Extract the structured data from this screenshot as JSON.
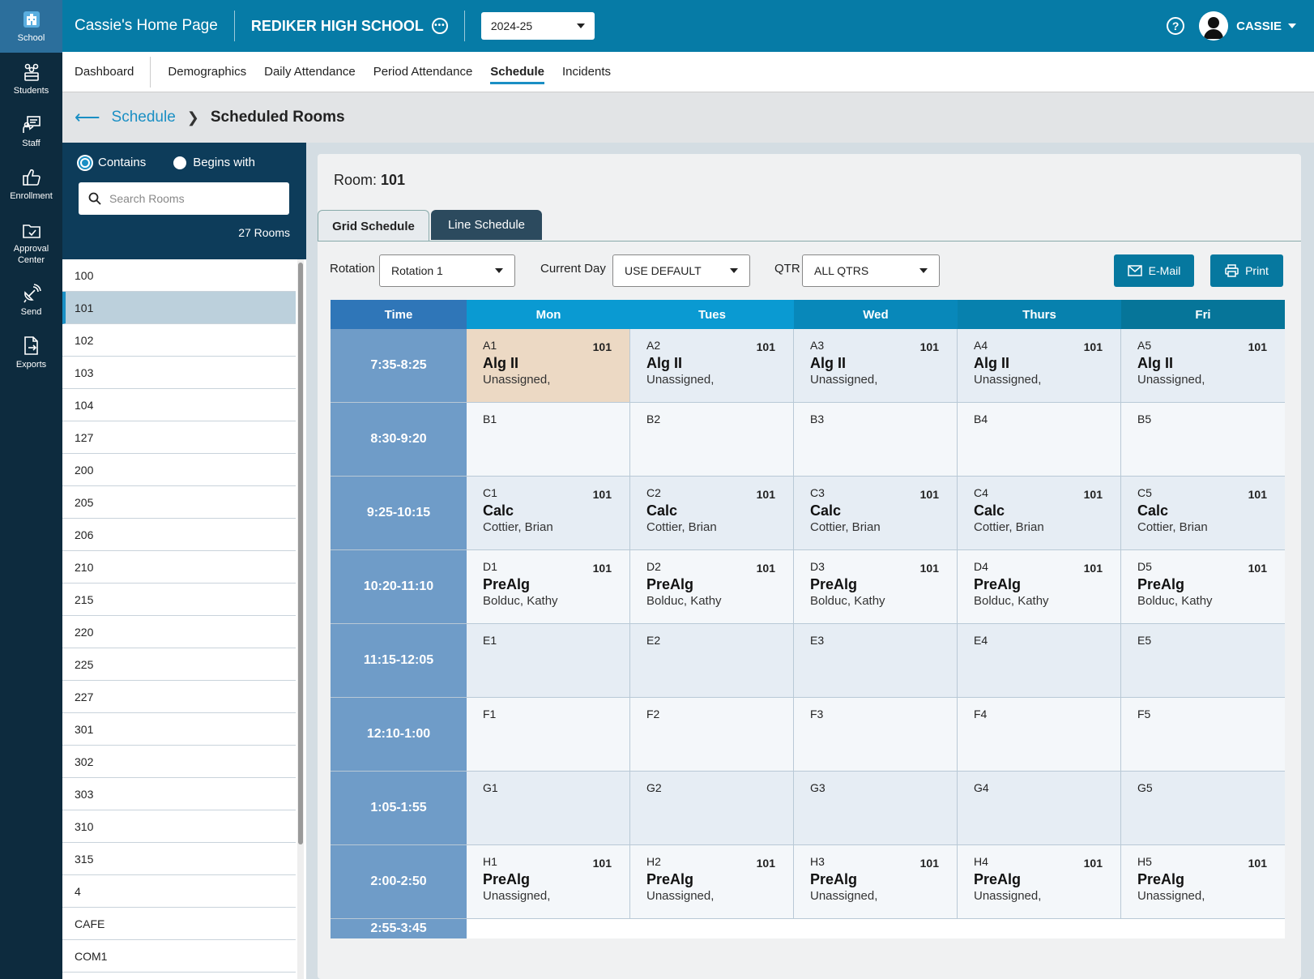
{
  "rail": [
    {
      "label": "School",
      "icon": "school-icon",
      "active": true
    },
    {
      "label": "Students",
      "icon": "students-icon"
    },
    {
      "label": "Staff",
      "icon": "staff-icon"
    },
    {
      "label": "Enrollment",
      "icon": "thumbs-up-icon"
    },
    {
      "label": "Approval Center",
      "icon": "folder-icon"
    },
    {
      "label": "Send",
      "icon": "satellite-icon"
    },
    {
      "label": "Exports",
      "icon": "export-file-icon"
    }
  ],
  "header": {
    "home_title": "Cassie's Home Page",
    "school_name": "REDIKER HIGH SCHOOL",
    "year": "2024-25",
    "user": "CASSIE"
  },
  "nav": {
    "items": [
      "Dashboard",
      "Demographics",
      "Daily Attendance",
      "Period Attendance",
      "Schedule",
      "Incidents"
    ],
    "active": "Schedule"
  },
  "breadcrumb": {
    "parent": "Schedule",
    "current": "Scheduled Rooms"
  },
  "rooms": {
    "contains_label": "Contains",
    "begins_label": "Begins with",
    "search_placeholder": "Search Rooms",
    "count_text": "27 Rooms",
    "selected": "101",
    "list": [
      "100",
      "101",
      "102",
      "103",
      "104",
      "127",
      "200",
      "205",
      "206",
      "210",
      "215",
      "220",
      "225",
      "227",
      "301",
      "302",
      "303",
      "310",
      "315",
      "4",
      "CAFE",
      "COM1"
    ]
  },
  "main": {
    "room_label": "Room:",
    "room_value": "101",
    "tabs": {
      "grid": "Grid Schedule",
      "line": "Line Schedule"
    },
    "rotation_label": "Rotation",
    "rotation_value": "Rotation 1",
    "current_day_label": "Current Day",
    "current_day_value": "USE DEFAULT",
    "qtr_label": "QTR",
    "qtr_value": "ALL QTRS",
    "email_label": "E-Mail",
    "print_label": "Print"
  },
  "grid": {
    "time_header": "Time",
    "days": [
      {
        "name": "Mon",
        "color": "#0a9ad2"
      },
      {
        "name": "Tues",
        "color": "#0a9ad2"
      },
      {
        "name": "Wed",
        "color": "#0888ba"
      },
      {
        "name": "Thurs",
        "color": "#0781ae"
      },
      {
        "name": "Fri",
        "color": "#067599"
      }
    ],
    "time_header_color": "#2f76b8",
    "highlight_color": "#ecd9c4",
    "rows": [
      {
        "time": "7:35-8:25",
        "cells": [
          {
            "code": "A1",
            "room": "101",
            "course": "Alg II",
            "teacher": "Unassigned,",
            "highlight": true
          },
          {
            "code": "A2",
            "room": "101",
            "course": "Alg II",
            "teacher": "Unassigned,"
          },
          {
            "code": "A3",
            "room": "101",
            "course": "Alg II",
            "teacher": "Unassigned,"
          },
          {
            "code": "A4",
            "room": "101",
            "course": "Alg II",
            "teacher": "Unassigned,"
          },
          {
            "code": "A5",
            "room": "101",
            "course": "Alg II",
            "teacher": "Unassigned,"
          }
        ]
      },
      {
        "time": "8:30-9:20",
        "cells": [
          {
            "code": "B1",
            "room": "",
            "course": "",
            "teacher": ""
          },
          {
            "code": "B2",
            "room": "",
            "course": "",
            "teacher": ""
          },
          {
            "code": "B3",
            "room": "",
            "course": "",
            "teacher": ""
          },
          {
            "code": "B4",
            "room": "",
            "course": "",
            "teacher": ""
          },
          {
            "code": "B5",
            "room": "",
            "course": "",
            "teacher": ""
          }
        ]
      },
      {
        "time": "9:25-10:15",
        "cells": [
          {
            "code": "C1",
            "room": "101",
            "course": "Calc",
            "teacher": "Cottier, Brian"
          },
          {
            "code": "C2",
            "room": "101",
            "course": "Calc",
            "teacher": "Cottier, Brian"
          },
          {
            "code": "C3",
            "room": "101",
            "course": "Calc",
            "teacher": "Cottier, Brian"
          },
          {
            "code": "C4",
            "room": "101",
            "course": "Calc",
            "teacher": "Cottier, Brian"
          },
          {
            "code": "C5",
            "room": "101",
            "course": "Calc",
            "teacher": "Cottier, Brian"
          }
        ]
      },
      {
        "time": "10:20-11:10",
        "cells": [
          {
            "code": "D1",
            "room": "101",
            "course": "PreAlg",
            "teacher": "Bolduc, Kathy"
          },
          {
            "code": "D2",
            "room": "101",
            "course": "PreAlg",
            "teacher": "Bolduc, Kathy"
          },
          {
            "code": "D3",
            "room": "101",
            "course": "PreAlg",
            "teacher": "Bolduc, Kathy"
          },
          {
            "code": "D4",
            "room": "101",
            "course": "PreAlg",
            "teacher": "Bolduc, Kathy"
          },
          {
            "code": "D5",
            "room": "101",
            "course": "PreAlg",
            "teacher": "Bolduc, Kathy"
          }
        ]
      },
      {
        "time": "11:15-12:05",
        "cells": [
          {
            "code": "E1",
            "room": "",
            "course": "",
            "teacher": ""
          },
          {
            "code": "E2",
            "room": "",
            "course": "",
            "teacher": ""
          },
          {
            "code": "E3",
            "room": "",
            "course": "",
            "teacher": ""
          },
          {
            "code": "E4",
            "room": "",
            "course": "",
            "teacher": ""
          },
          {
            "code": "E5",
            "room": "",
            "course": "",
            "teacher": ""
          }
        ]
      },
      {
        "time": "12:10-1:00",
        "cells": [
          {
            "code": "F1",
            "room": "",
            "course": "",
            "teacher": ""
          },
          {
            "code": "F2",
            "room": "",
            "course": "",
            "teacher": ""
          },
          {
            "code": "F3",
            "room": "",
            "course": "",
            "teacher": ""
          },
          {
            "code": "F4",
            "room": "",
            "course": "",
            "teacher": ""
          },
          {
            "code": "F5",
            "room": "",
            "course": "",
            "teacher": ""
          }
        ]
      },
      {
        "time": "1:05-1:55",
        "cells": [
          {
            "code": "G1",
            "room": "",
            "course": "",
            "teacher": ""
          },
          {
            "code": "G2",
            "room": "",
            "course": "",
            "teacher": ""
          },
          {
            "code": "G3",
            "room": "",
            "course": "",
            "teacher": ""
          },
          {
            "code": "G4",
            "room": "",
            "course": "",
            "teacher": ""
          },
          {
            "code": "G5",
            "room": "",
            "course": "",
            "teacher": ""
          }
        ]
      },
      {
        "time": "2:00-2:50",
        "cells": [
          {
            "code": "H1",
            "room": "101",
            "course": "PreAlg",
            "teacher": "Unassigned,"
          },
          {
            "code": "H2",
            "room": "101",
            "course": "PreAlg",
            "teacher": "Unassigned,"
          },
          {
            "code": "H3",
            "room": "101",
            "course": "PreAlg",
            "teacher": "Unassigned,"
          },
          {
            "code": "H4",
            "room": "101",
            "course": "PreAlg",
            "teacher": "Unassigned,"
          },
          {
            "code": "H5",
            "room": "101",
            "course": "PreAlg",
            "teacher": "Unassigned,"
          }
        ]
      }
    ],
    "last_time": "2:55-3:45"
  }
}
